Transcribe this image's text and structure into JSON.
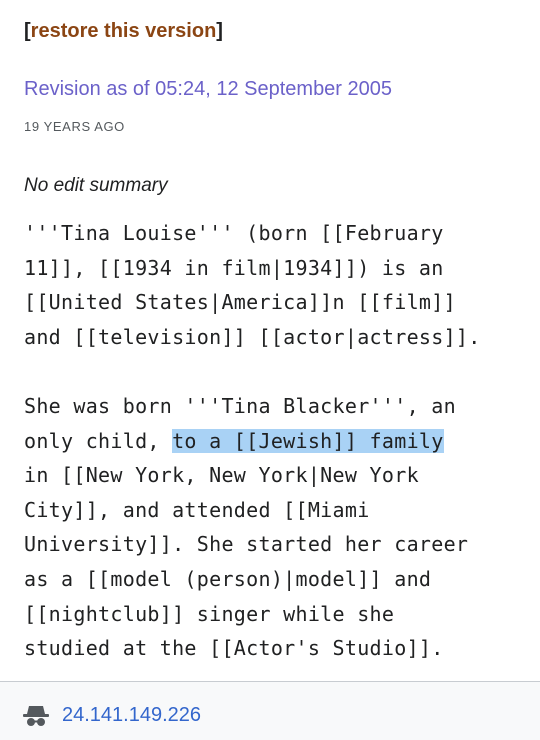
{
  "restore": {
    "open_bracket": "[",
    "label": "restore this version",
    "close_bracket": "]"
  },
  "revision": {
    "title": "Revision as of 05:24, 12 September 2005",
    "relative_time": "19 YEARS AGO",
    "summary": "No edit summary"
  },
  "content": {
    "paragraph1": [
      "'''Tina Louise''' (born [[February",
      "11]], [[1934 in film|1934]]) is an",
      "[[United States|America]]n [[film]]",
      "and [[television]] [[actor|actress]]."
    ],
    "paragraph2": {
      "line1": "She was born '''Tina Blacker''', an",
      "line2_before": "only child, ",
      "line2_highlight": "to a [[Jewish]] family",
      "line3": "in [[New York, New York|New York",
      "line4": "City]], and attended [[Miami",
      "line5": "University]]. She started her career",
      "line6": "as a [[model (person)|model]] and",
      "line7": "[[nightclub]] singer while she",
      "line8": "studied at the [[Actor's Studio]]."
    }
  },
  "author": {
    "icon": "anonymous-user-icon",
    "ip": "24.141.149.226"
  },
  "colors": {
    "restore_link": "#8b4513",
    "revision_link": "#6b61c9",
    "highlight": "#a9d2f5",
    "ip_link": "#3366cc"
  }
}
